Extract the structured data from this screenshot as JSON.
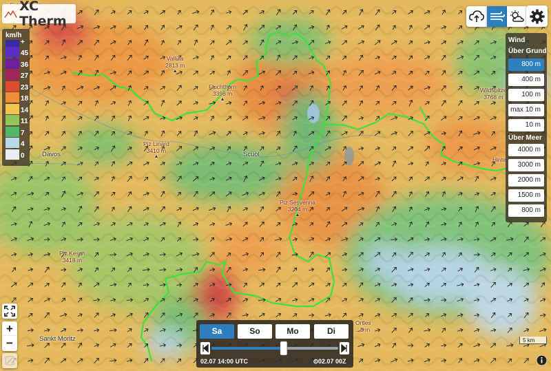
{
  "app": {
    "title": "XC Therm"
  },
  "toolbar": {
    "buttons": [
      {
        "icon": "cloud-upload-icon",
        "active": false
      },
      {
        "icon": "wind-icon",
        "active": true
      },
      {
        "icon": "sun-cloud-icon",
        "active": false
      },
      {
        "icon": "gear-icon",
        "active": false
      }
    ]
  },
  "legend": {
    "unit": "km/h",
    "top_label": "+",
    "items": [
      {
        "value": "45",
        "color": "#5a2ec4"
      },
      {
        "value": "36",
        "color": "#6f1f9e"
      },
      {
        "value": "27",
        "color": "#a3245a"
      },
      {
        "value": "23",
        "color": "#e04a33"
      },
      {
        "value": "18",
        "color": "#f08f3a"
      },
      {
        "value": "14",
        "color": "#f2c44d"
      },
      {
        "value": "11",
        "color": "#8ec65a"
      },
      {
        "value": "7",
        "color": "#4fb866"
      },
      {
        "value": "4",
        "color": "#b8d8ea"
      },
      {
        "value": "0",
        "color": "#e8eef3"
      }
    ],
    "top_color": "#3a2c9e"
  },
  "wind_panel": {
    "title": "Wind",
    "ground_heading": "Über Grund",
    "ground_levels": [
      "800 m",
      "400 m",
      "100 m",
      "max 10 m",
      "10 m"
    ],
    "selected": "800 m",
    "sea_heading": "Über Meer",
    "sea_levels": [
      "4000 m",
      "3000 m",
      "2000 m",
      "1500 m",
      "800 m"
    ]
  },
  "time_panel": {
    "days": [
      "Sa",
      "So",
      "Mo",
      "Di"
    ],
    "selected_day": "Sa",
    "current_time": "02.07 14:00 UTC",
    "model_run": "02.07 00Z",
    "slider_position": 0.57
  },
  "scale": {
    "label": "5 km"
  },
  "map": {
    "places": [
      {
        "name": "Davos"
      },
      {
        "name": "Scuol"
      },
      {
        "name": "Sankt Moritz"
      }
    ],
    "peaks": [
      {
        "name": "Großer Turm",
        "elev": ""
      },
      {
        "name": "Vallüla",
        "elev": "2813 m"
      },
      {
        "name": "Fluchthorn",
        "elev": "3398 m"
      },
      {
        "name": "Piz Linard",
        "elev": "3410 m"
      },
      {
        "name": "Piz Sesvenna",
        "elev": "3204 m"
      },
      {
        "name": "Piz Kesch",
        "elev": "3418 m"
      },
      {
        "name": "Wildspitze",
        "elev": "3768 m"
      },
      {
        "name": "Hinter...",
        "elev": ""
      },
      {
        "name": "Ortles",
        "elev": "...5 m"
      }
    ]
  }
}
